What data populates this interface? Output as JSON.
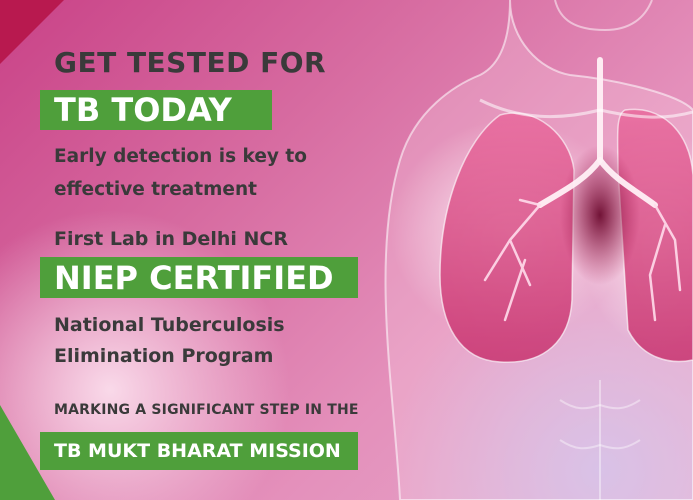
{
  "headline": "GET TESTED FOR",
  "banner_primary": "TB TODAY",
  "subhead": "Early detection is key to effective treatment",
  "lab_claim": "First Lab in Delhi NCR",
  "banner_certified": "NIEP CERTIFIED",
  "program_name": "National Tuberculosis Elimination Program",
  "tagline": "MARKING A SIGNIFICANT STEP IN THE",
  "banner_mission": "TB MUKT BHARAT MISSION",
  "colors": {
    "accent_green": "#4f9f3b",
    "accent_crimson": "#b8194f",
    "background_pink": "#d76ca1",
    "text_dark": "#3a3a3a"
  }
}
